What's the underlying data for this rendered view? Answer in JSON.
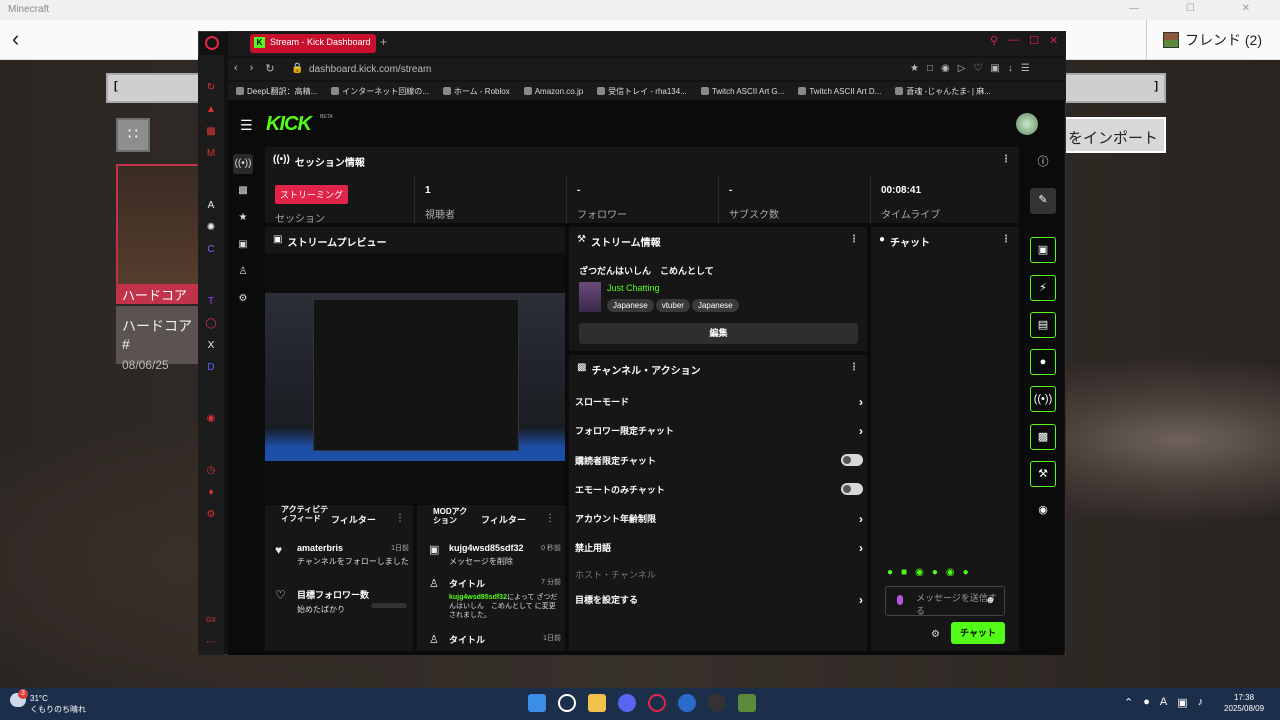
{
  "minecraft": {
    "title": "Minecraft",
    "window_controls": "— ☐ ✕",
    "friends": "フレンド (2)",
    "import_btn": "をインポート",
    "field_left": "[",
    "field_right": "]",
    "world_badge": "ハードコア",
    "world_title": "ハードコア#",
    "world_date": "08/06/25"
  },
  "browser": {
    "tab_title": "Stream - Kick Dashboard",
    "url": "dashboard.kick.com/stream",
    "bookmarks": [
      "DeepL翻訳：高精...",
      "インターネット回線の...",
      "ホーム - Roblox",
      "Amazon.co.jp",
      "受信トレイ - rha134...",
      "Twitch ASCII Art G...",
      "Twitch ASCII Art D...",
      "蒼魂 -じゃんたま- | 麻..."
    ]
  },
  "kick": {
    "logo": "KICK",
    "beta": "BETA",
    "session": {
      "title": "セッション情報",
      "badge": "ストリーミング",
      "session_label": "セッション",
      "viewers": "1",
      "viewers_label": "視聴者",
      "followers": "-",
      "followers_label": "フォロワー",
      "subs": "-",
      "subs_label": "サブスク数",
      "time": "00:08:41",
      "time_label": "タイムライブ"
    },
    "preview": {
      "title": "ストリームプレビュー"
    },
    "stream_info": {
      "title": "ストリーム情報",
      "stream_title": "ざつだんはいしん　こめんとして",
      "category": "Just Chatting",
      "tags": [
        "Japanese",
        "vtuber",
        "Japanese"
      ],
      "edit": "編集"
    },
    "chat": {
      "title": "チャット",
      "placeholder": "メッセージを送信する",
      "send": "チャット"
    },
    "channel_actions": {
      "title": "チャンネル・アクション",
      "items": [
        "スローモード",
        "フォロワー限定チャット",
        "購読者限定チャット",
        "エモートのみチャット",
        "アカウント年齢制限",
        "禁止用語",
        "ホスト・チャンネル",
        "目標を設定する"
      ]
    },
    "activity": {
      "title": "アクティビティフィード",
      "filter": "フィルター",
      "items": [
        {
          "name": "amaterbris",
          "time": "1日前",
          "desc": "チャンネルをフォローしました"
        },
        {
          "name": "目標フォロワー数",
          "desc": "始めたばかり"
        }
      ]
    },
    "mod": {
      "title": "MODアクション",
      "filter": "フィルター",
      "items": [
        {
          "name": "kujg4wsd85sdf32",
          "time": "0 秒前",
          "desc": "メッセージを削除"
        },
        {
          "name": "タイトル",
          "time": "7 分前",
          "user": "kujg4wsd85sdf32",
          "desc": "によって ざつだんはいしん　こめんとして に変更されました。"
        },
        {
          "name": "タイトル",
          "time": "1日前"
        }
      ]
    }
  },
  "taskbar": {
    "temp": "31°C",
    "weather": "くもりのち晴れ",
    "badge": "3",
    "time": "17:38",
    "date": "2025/08/09",
    "lang": "A"
  }
}
